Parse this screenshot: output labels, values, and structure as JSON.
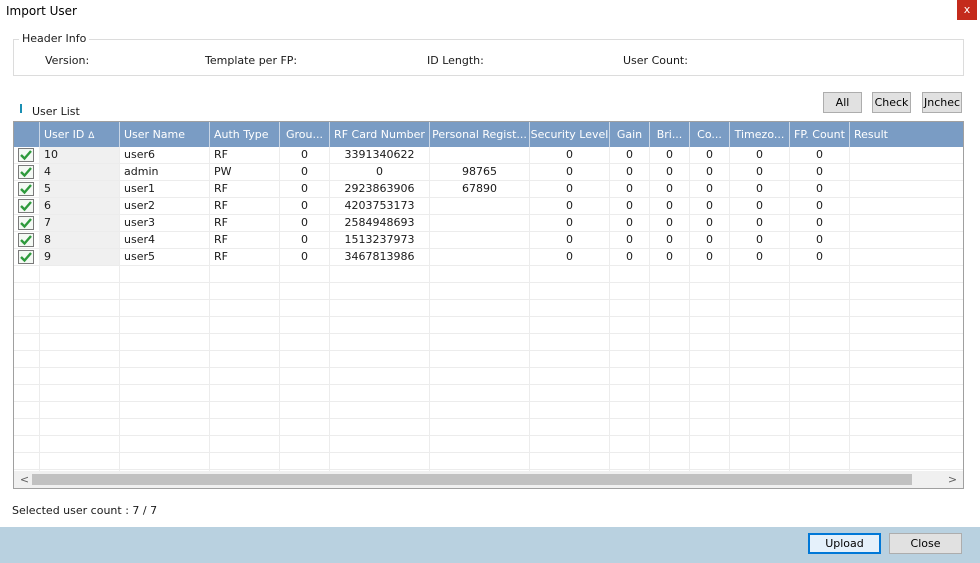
{
  "window": {
    "title": "Import User",
    "close_glyph": "x"
  },
  "header_info": {
    "title": "Header Info",
    "version_label": "Version:",
    "template_label": "Template per FP:",
    "id_length_label": "ID Length:",
    "user_count_label": "User Count:"
  },
  "user_list": {
    "title": "User List"
  },
  "buttons": {
    "all": "All",
    "check": "Check",
    "uncheck": "Jncheck",
    "upload": "Upload",
    "close": "Close"
  },
  "table": {
    "columns": [
      "User ID",
      "User Name",
      "Auth Type",
      "Grou...",
      "RF Card Number",
      "Personal Regist...",
      "Security Level",
      "Gain",
      "Bri...",
      "Co...",
      "Timezo...",
      "FP. Count",
      "Result"
    ],
    "sort_icon": "Δ",
    "rows": [
      [
        "10",
        "user6",
        "RF",
        "0",
        "3391340622",
        "",
        "0",
        "0",
        "0",
        "0",
        "0",
        "0",
        ""
      ],
      [
        "4",
        "admin",
        "PW",
        "0",
        "0",
        "98765",
        "0",
        "0",
        "0",
        "0",
        "0",
        "0",
        ""
      ],
      [
        "5",
        "user1",
        "RF",
        "0",
        "2923863906",
        "67890",
        "0",
        "0",
        "0",
        "0",
        "0",
        "0",
        ""
      ],
      [
        "6",
        "user2",
        "RF",
        "0",
        "4203753173",
        "",
        "0",
        "0",
        "0",
        "0",
        "0",
        "0",
        ""
      ],
      [
        "7",
        "user3",
        "RF",
        "0",
        "2584948693",
        "",
        "0",
        "0",
        "0",
        "0",
        "0",
        "0",
        ""
      ],
      [
        "8",
        "user4",
        "RF",
        "0",
        "1513237973",
        "",
        "0",
        "0",
        "0",
        "0",
        "0",
        "0",
        ""
      ],
      [
        "9",
        "user5",
        "RF",
        "0",
        "3467813986",
        "",
        "0",
        "0",
        "0",
        "0",
        "0",
        "0",
        ""
      ]
    ]
  },
  "scroll": {
    "left_glyph": "<",
    "right_glyph": ">"
  },
  "status": {
    "selected_count": "Selected user count : 7 / 7"
  },
  "colors": {
    "header_bg": "#7a9cc4",
    "bottom_bar": "#b9d1e0",
    "check_green": "#2e9a3c",
    "close_red": "#c42b1c"
  },
  "icons": {
    "row_check": "check-icon",
    "sort": "sort-ascending-icon"
  }
}
